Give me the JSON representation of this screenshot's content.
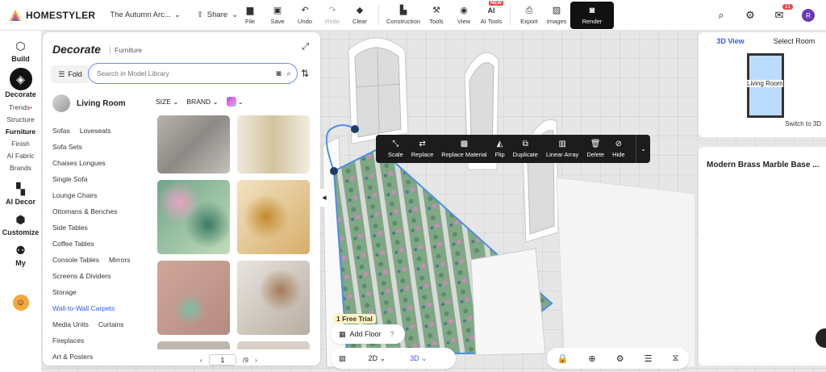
{
  "app": {
    "name": "HOMESTYLER",
    "project_title": "The Autumn Arc...",
    "share_label": "Share"
  },
  "toolbar": [
    {
      "label": "File",
      "icon": "folder-icon"
    },
    {
      "label": "Save",
      "icon": "save-icon"
    },
    {
      "label": "Undo",
      "icon": "undo-icon"
    },
    {
      "label": "Redo",
      "icon": "redo-icon",
      "disabled": true
    },
    {
      "label": "Clear",
      "icon": "clear-icon"
    },
    {
      "label": "Construction",
      "icon": "construction-icon"
    },
    {
      "label": "Tools",
      "icon": "tools-icon"
    },
    {
      "label": "View",
      "icon": "eye-icon"
    },
    {
      "label": "AI Tools",
      "icon": "ai-icon",
      "tag": "NEW"
    },
    {
      "label": "Export",
      "icon": "export-icon"
    },
    {
      "label": "Images",
      "icon": "images-icon"
    },
    {
      "label": "Render",
      "icon": "camera-icon"
    }
  ],
  "header_right": {
    "notification_count": "11",
    "avatar_letter": "R"
  },
  "rail": {
    "build": "Build",
    "decorate": "Decorate",
    "decorate_subs": [
      "Trends",
      "Structure",
      "Furniture",
      "Finish",
      "AI Fabric",
      "Brands"
    ],
    "ai_decor": "AI Decor",
    "customize": "Customize",
    "my": "My"
  },
  "panel": {
    "title": "Decorate",
    "subtitle": "Furniture",
    "fold_label": "Fold",
    "search_placeholder": "Search in Model Library",
    "room": "Living Room",
    "filter_size": "SIZE",
    "filter_brand": "BRAND",
    "categories": [
      [
        "Sofas",
        "Loveseats"
      ],
      [
        "Sofa Sets"
      ],
      [
        "Chaises Longues"
      ],
      [
        "Single Sofa"
      ],
      [
        "Lounge Chairs"
      ],
      [
        "Ottomans & Benches"
      ],
      [
        "Side Tables"
      ],
      [
        "Coffee Tables"
      ],
      [
        "Console Tables",
        "Mirrors"
      ],
      [
        "Screens & Dividers"
      ],
      [
        "Storage"
      ],
      [
        "Wall-to-Wall Carpets"
      ],
      [
        "Media Units",
        "Curtains"
      ],
      [
        "Fireplaces"
      ],
      [
        "Art & Posters"
      ]
    ],
    "active_category": "Wall-to-Wall Carpets",
    "page_current": "1",
    "page_total": "/9"
  },
  "context_toolbar": [
    {
      "label": "Scale",
      "icon": "scale-icon"
    },
    {
      "label": "Replace",
      "icon": "replace-icon"
    },
    {
      "label": "Replace Material",
      "icon": "material-icon"
    },
    {
      "label": "Flip",
      "icon": "flip-icon"
    },
    {
      "label": "Duplicate",
      "icon": "duplicate-icon"
    },
    {
      "label": "Linear Array",
      "icon": "array-icon"
    },
    {
      "label": "Delete",
      "icon": "trash-icon"
    },
    {
      "label": "Hide",
      "icon": "hide-icon"
    }
  ],
  "minimap": {
    "tab_3d": "3D View",
    "tab_select": "Select Room",
    "room_label": "Living Room",
    "switch": "Switch to 3D"
  },
  "info_panel": {
    "title": "Modern Brass Marble Base ..."
  },
  "bottom": {
    "trial": "1 Free Trial",
    "add_floor": "Add Floor",
    "view_2d": "2D",
    "view_3d": "3D"
  },
  "colors": {
    "accent": "#2d5bff",
    "selection": "#4a90e2",
    "dark": "#1c1c1c"
  }
}
